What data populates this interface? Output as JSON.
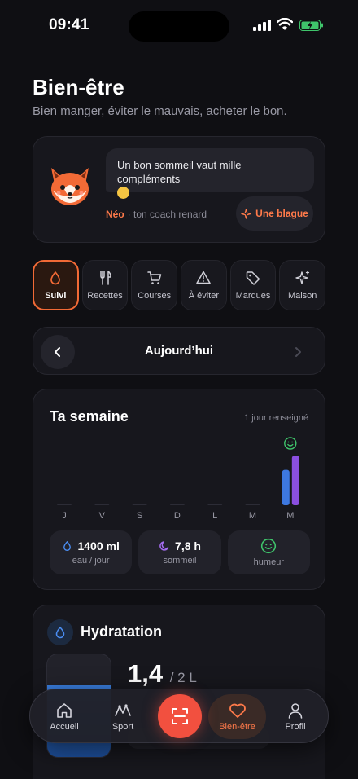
{
  "status": {
    "time": "09:41"
  },
  "header": {
    "title": "Bien-être",
    "subtitle": "Bien manger, éviter le mauvais, acheter le bon."
  },
  "coach": {
    "message": "Un bon sommeil vaut mille compléments",
    "name": "Néo",
    "role": "· ton coach renard",
    "joke_label": "Une blague"
  },
  "tabs": [
    {
      "label": "Suivi",
      "icon": "drop-icon",
      "active": true
    },
    {
      "label": "Recettes",
      "icon": "utensils-icon"
    },
    {
      "label": "Courses",
      "icon": "cart-icon"
    },
    {
      "label": "À éviter",
      "icon": "warning-icon"
    },
    {
      "label": "Marques",
      "icon": "tag-icon"
    },
    {
      "label": "Maison",
      "icon": "sparkle-icon"
    }
  ],
  "day_nav": {
    "label": "Aujourd’hui"
  },
  "week": {
    "title": "Ta semaine",
    "filled": "1 jour renseigné",
    "days": [
      "J",
      "V",
      "S",
      "D",
      "L",
      "M",
      "M"
    ],
    "chart_data": {
      "type": "bar",
      "categories": [
        "J",
        "V",
        "S",
        "D",
        "L",
        "M",
        "M"
      ],
      "series": [
        {
          "values": [
            0,
            0,
            0,
            0,
            0,
            0,
            0.7
          ],
          "color": "#3d78e0"
        },
        {
          "values": [
            0,
            0,
            0,
            0,
            0,
            0,
            0.98
          ],
          "color": "#8b4fe0"
        }
      ],
      "mood": [
        null,
        null,
        null,
        null,
        null,
        null,
        "smile"
      ]
    },
    "stats": [
      {
        "value": "1400 ml",
        "label": "eau / jour",
        "icon": "drop-icon"
      },
      {
        "value": "7,8 h",
        "label": "sommeil",
        "icon": "moon-icon"
      },
      {
        "value": "",
        "label": "humeur",
        "icon": "smile-icon"
      }
    ]
  },
  "hydration": {
    "title": "Hydratation",
    "amount": "1,4",
    "goal": "/ 2 L",
    "fill": 0.7
  },
  "nav": {
    "items": [
      {
        "label": "Accueil",
        "icon": "home-icon"
      },
      {
        "label": "Sport",
        "icon": "pulse-icon"
      },
      {
        "label": "Bien-être",
        "icon": "heart-icon",
        "active": true
      },
      {
        "label": "Profil",
        "icon": "user-icon"
      }
    ]
  },
  "colors": {
    "accent": "#f26a36",
    "water": "#3d78e0",
    "sleep": "#8b4fe0",
    "mood": "#3fc46b"
  }
}
